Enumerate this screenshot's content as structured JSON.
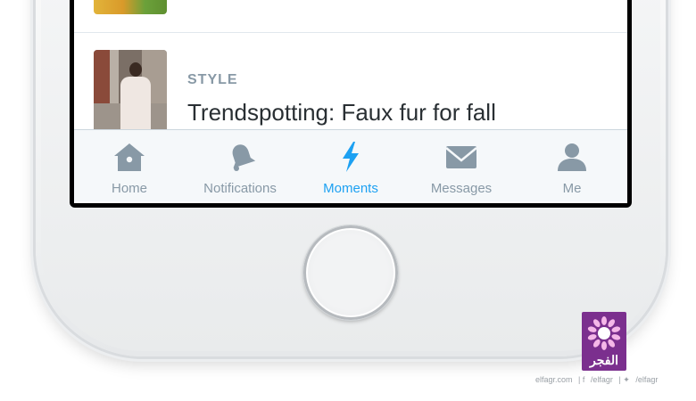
{
  "feed": {
    "item": {
      "category": "STYLE",
      "headline": "Trendspotting: Faux fur for fall"
    }
  },
  "tabbar": {
    "tabs": [
      {
        "label": "Home",
        "icon": "home-icon",
        "active": false
      },
      {
        "label": "Notifications",
        "icon": "bell-icon",
        "active": false
      },
      {
        "label": "Moments",
        "icon": "lightning-icon",
        "active": true
      },
      {
        "label": "Messages",
        "icon": "envelope-icon",
        "active": false
      },
      {
        "label": "Me",
        "icon": "person-icon",
        "active": false
      }
    ]
  },
  "colors": {
    "accent": "#1da1f2",
    "inactive": "#8899a6",
    "logo_bg": "#7b2f8e"
  },
  "watermark": {
    "logo_text": "الفجر",
    "site": "elfagr.com",
    "facebook": "/elfagr",
    "twitter": "/elfagr"
  }
}
